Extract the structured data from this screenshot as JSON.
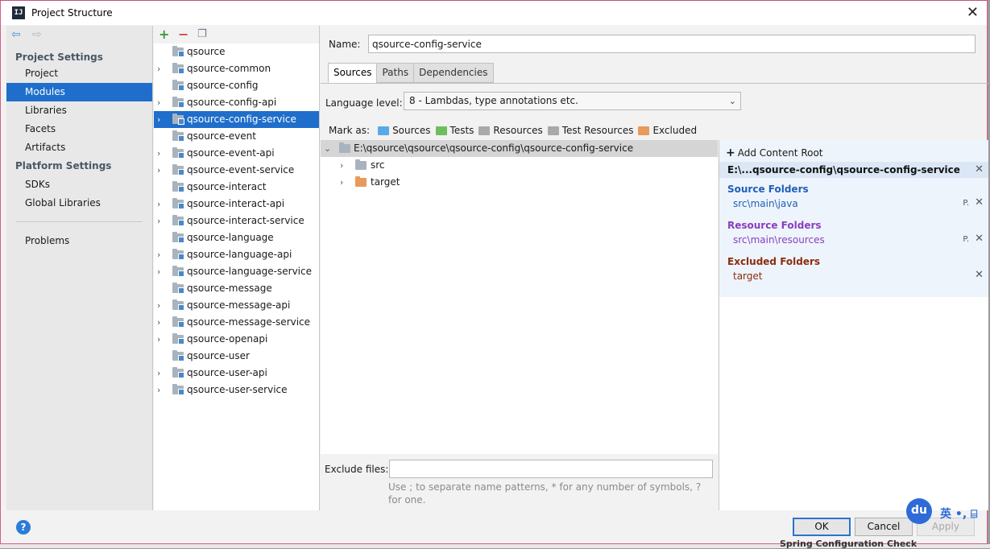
{
  "window": {
    "title": "Project Structure",
    "icon_text": "IJ",
    "close": "✕"
  },
  "nav": {
    "back": "⇦",
    "forward": "⇨",
    "project_settings_header": "Project Settings",
    "project_settings": [
      "Project",
      "Modules",
      "Libraries",
      "Facets",
      "Artifacts"
    ],
    "platform_settings_header": "Platform Settings",
    "platform_settings": [
      "SDKs",
      "Global Libraries"
    ],
    "problems": "Problems",
    "selected": "Modules"
  },
  "toolbar": {
    "add": "+",
    "remove": "−",
    "copy": "❐"
  },
  "modules": [
    {
      "name": "qsource",
      "expandable": false
    },
    {
      "name": "qsource-common",
      "expandable": true
    },
    {
      "name": "qsource-config",
      "expandable": false
    },
    {
      "name": "qsource-config-api",
      "expandable": true
    },
    {
      "name": "qsource-config-service",
      "expandable": true,
      "selected": true
    },
    {
      "name": "qsource-event",
      "expandable": false
    },
    {
      "name": "qsource-event-api",
      "expandable": true
    },
    {
      "name": "qsource-event-service",
      "expandable": true
    },
    {
      "name": "qsource-interact",
      "expandable": false
    },
    {
      "name": "qsource-interact-api",
      "expandable": true
    },
    {
      "name": "qsource-interact-service",
      "expandable": true
    },
    {
      "name": "qsource-language",
      "expandable": false
    },
    {
      "name": "qsource-language-api",
      "expandable": true
    },
    {
      "name": "qsource-language-service",
      "expandable": true
    },
    {
      "name": "qsource-message",
      "expandable": false
    },
    {
      "name": "qsource-message-api",
      "expandable": true
    },
    {
      "name": "qsource-message-service",
      "expandable": true
    },
    {
      "name": "qsource-openapi",
      "expandable": true
    },
    {
      "name": "qsource-user",
      "expandable": false
    },
    {
      "name": "qsource-user-api",
      "expandable": true
    },
    {
      "name": "qsource-user-service",
      "expandable": true
    }
  ],
  "detail": {
    "name_label": "Name:",
    "name_value": "qsource-config-service",
    "tabs": [
      "Sources",
      "Paths",
      "Dependencies"
    ],
    "active_tab": "Sources",
    "language_label": "Language level:",
    "language_value": "8 - Lambdas, type annotations etc.",
    "mark_as_label": "Mark as:",
    "mark_as": [
      {
        "label": "Sources",
        "color": "#5aa9e6"
      },
      {
        "label": "Tests",
        "color": "#6cbf5a"
      },
      {
        "label": "Resources",
        "color": "#a9a9a9"
      },
      {
        "label": "Test Resources",
        "color": "#a9a9a9"
      },
      {
        "label": "Excluded",
        "color": "#e89a5c"
      }
    ],
    "tree": {
      "root": "E:\\qsource\\qsource\\qsource-config\\qsource-config-service",
      "children": [
        {
          "name": "src",
          "color": "#a9b3bd"
        },
        {
          "name": "target",
          "color": "#e89a5c"
        }
      ]
    },
    "exclude_label": "Exclude files:",
    "exclude_value": "",
    "exclude_hint": "Use ; to separate name patterns, * for any number of symbols, ? for one."
  },
  "content_root": {
    "add_label": "Add Content Root",
    "path": "E:\\...qsource-config\\qsource-config-service",
    "source_header": "Source Folders",
    "source_value": "src\\main\\java",
    "resource_header": "Resource Folders",
    "resource_value": "src\\main\\resources",
    "excluded_header": "Excluded Folders",
    "excluded_value": "target",
    "colors": {
      "source": "#1f5fb8",
      "resource": "#8a3fbf",
      "excluded": "#8a2d0f"
    }
  },
  "footer": {
    "help": "?",
    "ok": "OK",
    "cancel": "Cancel",
    "apply": "Apply"
  },
  "ime": {
    "du": "du",
    "rest": "英 •, ⌸"
  },
  "background": {
    "status": "Spring Configuration Check"
  }
}
